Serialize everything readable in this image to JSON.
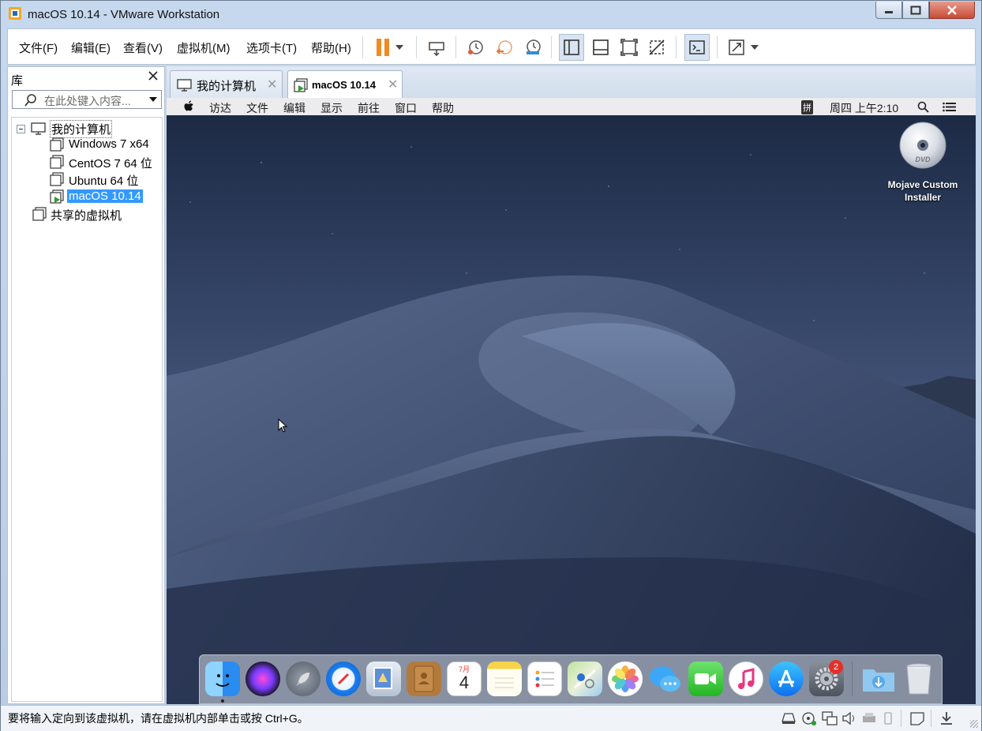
{
  "window": {
    "title": "macOS 10.14 - VMware Workstation"
  },
  "menu": [
    "文件(F)",
    "编辑(E)",
    "查看(V)",
    "虚拟机(M)",
    "选项卡(T)",
    "帮助(H)"
  ],
  "library": {
    "title": "库",
    "search_placeholder": "在此处键入内容...",
    "root": "我的计算机",
    "vms": [
      "Windows 7 x64",
      "CentOS 7 64 位",
      "Ubuntu 64 位",
      "macOS 10.14"
    ],
    "shared": "共享的虚拟机"
  },
  "tabs": [
    {
      "label": "我的计算机"
    },
    {
      "label": "macOS 10.14"
    }
  ],
  "mac": {
    "menu": [
      "访达",
      "文件",
      "编辑",
      "显示",
      "前往",
      "窗口",
      "帮助"
    ],
    "input_method": "拼",
    "clock": "周四 上午2:10",
    "desktop_icon_label": "Mojave Custom Installer",
    "dvd_text": "DVD",
    "calendar_month": "7月",
    "calendar_day": "4",
    "prefs_badge": "2"
  },
  "status": {
    "text": "要将输入定向到该虚拟机，请在虚拟机内部单击或按 Ctrl+G。"
  },
  "colors": {
    "accent": "#3399ff",
    "pause": "#f08a24"
  }
}
